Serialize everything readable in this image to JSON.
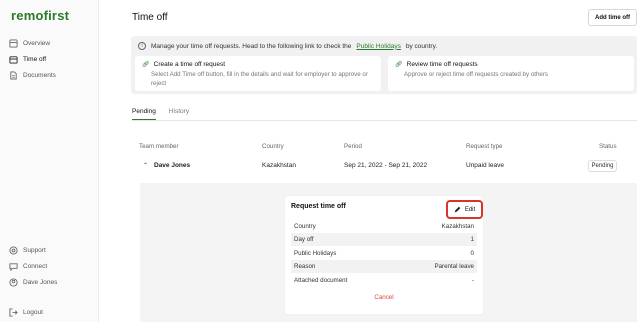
{
  "sidebar": {
    "logo": "remofirst",
    "items": [
      {
        "label": "Overview",
        "icon": "overview-icon"
      },
      {
        "label": "Time off",
        "icon": "calendar-icon"
      },
      {
        "label": "Documents",
        "icon": "document-icon"
      }
    ],
    "bottom": [
      {
        "label": "Support",
        "icon": "support-icon"
      },
      {
        "label": "Connect",
        "icon": "chat-icon"
      },
      {
        "label": "Dave Jones",
        "icon": "user-icon"
      }
    ],
    "logout": "Logout"
  },
  "header": {
    "title": "Time off",
    "add_button": "Add time off"
  },
  "info": {
    "text_before": "Manage your time off requests. Head to the following link to check the",
    "link": "Public Holidays",
    "text_after": "by country.",
    "cards": [
      {
        "title": "Create a time off request",
        "desc": "Select Add Time off button, fill in the details and wait for employer to approve or reject"
      },
      {
        "title": "Review time off requests",
        "desc": "Approve or reject time off requests created by others"
      }
    ]
  },
  "tabs": [
    "Pending",
    "History"
  ],
  "table": {
    "columns": [
      "Team member",
      "Country",
      "Period",
      "Request type",
      "Status"
    ],
    "row": {
      "member": "Dave Jones",
      "country": "Kazakhstan",
      "period": "Sep 21, 2022 - Sep 21, 2022",
      "type": "Unpaid leave",
      "status": "Pending"
    }
  },
  "request": {
    "title": "Request time off",
    "edit": "Edit",
    "details": [
      {
        "label": "Country",
        "value": "Kazakhstan"
      },
      {
        "label": "Day off",
        "value": "1"
      },
      {
        "label": "Public Holidays",
        "value": "0"
      },
      {
        "label": "Reason",
        "value": "Parental leave"
      },
      {
        "label": "Attached document",
        "value": "-"
      }
    ],
    "cancel": "Cancel"
  },
  "colors": {
    "brand": "#2a7a2a",
    "highlight": "#d9342b",
    "cancel": "#e0443a"
  }
}
